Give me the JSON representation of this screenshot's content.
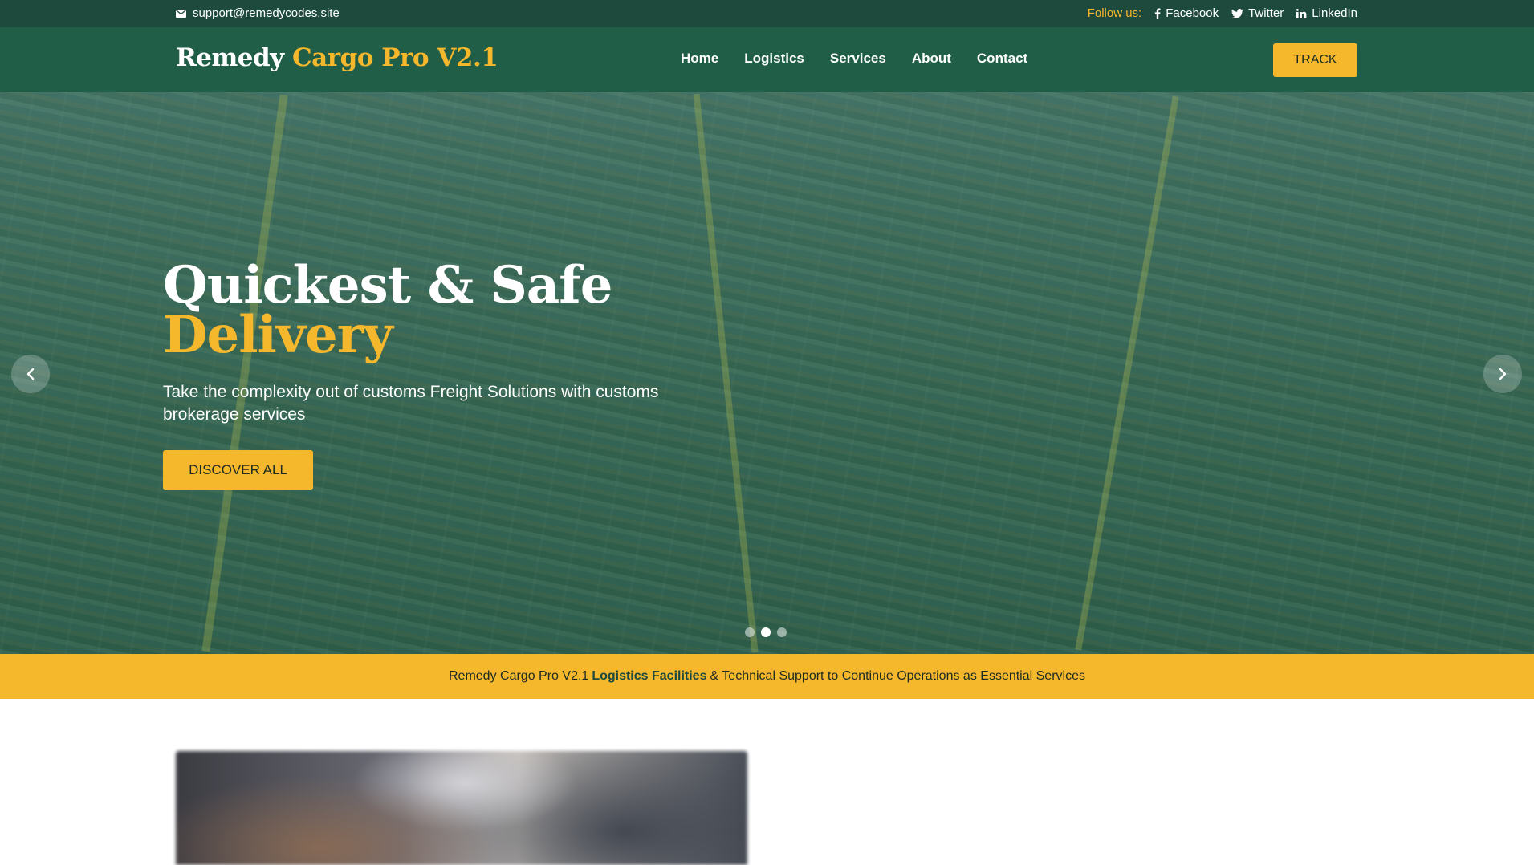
{
  "topbar": {
    "email": "support@remedycodes.site",
    "follow_label": "Follow us:",
    "social": [
      {
        "label": "Facebook",
        "icon": "facebook-icon"
      },
      {
        "label": "Twitter",
        "icon": "twitter-icon"
      },
      {
        "label": "LinkedIn",
        "icon": "linkedin-icon"
      }
    ]
  },
  "brand": {
    "part1": "Remedy",
    "part2": "Cargo Pro V2.1"
  },
  "nav": {
    "items": [
      "Home",
      "Logistics",
      "Services",
      "About",
      "Contact"
    ],
    "track_label": "TRACK"
  },
  "hero": {
    "title_line1": "Quickest & Safe",
    "title_line2": "Delivery",
    "subtitle": "Take the complexity out of customs Freight Solutions with customs brokerage services",
    "cta_label": "DISCOVER ALL",
    "slides_total": 3,
    "active_slide": 2
  },
  "banner": {
    "prefix": "Remedy Cargo Pro V2.1",
    "highlight": "Logistics Facilities",
    "suffix": "& Technical Support to Continue Operations as Essential Services"
  },
  "colors": {
    "topbar_bg": "#1d4a3d",
    "nav_bg": "#215e48",
    "accent": "#f5b72c"
  }
}
